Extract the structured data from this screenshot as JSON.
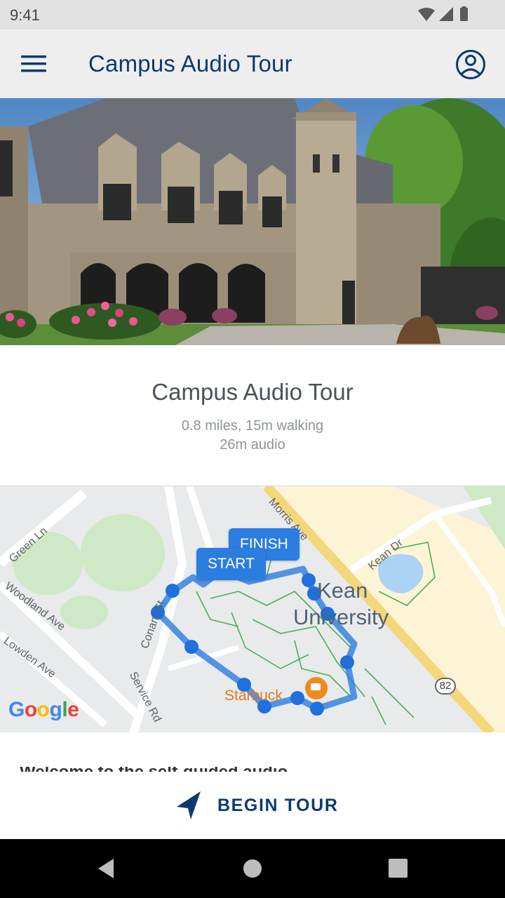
{
  "status_bar": {
    "time": "9:41",
    "icons": [
      "wifi-icon",
      "cell-signal-icon",
      "battery-icon"
    ]
  },
  "app_bar": {
    "menu_icon": "hamburger-menu-icon",
    "title": "Campus Audio Tour",
    "account_icon": "account-circle-icon"
  },
  "hero": {
    "image": "campus-building-photo"
  },
  "tour": {
    "title": "Campus Audio Tour",
    "distance": "0.8 miles, 15m walking",
    "audio": "26m audio"
  },
  "map": {
    "labels": {
      "green_ln": "Green Ln",
      "woodland_ave": "Woodland Ave",
      "lowden_ave": "Lowden Ave",
      "conant_st": "Conant St",
      "service_rd": "Service Rd",
      "morris_ave": "Morris Ave",
      "kean_dr": "Kean Dr",
      "kean_line1": "Kean",
      "kean_line2": "University",
      "starbucks": "Starbuck",
      "route_82": "82"
    },
    "finish_label": "FINISH",
    "start_label": "START",
    "attribution": "Google",
    "route_color": "#2b7de0"
  },
  "intro": {
    "text": "Welcome to the self-guided audio"
  },
  "begin_button": {
    "icon": "navigation-arrow-icon",
    "label": "BEGIN TOUR"
  },
  "nav_bar": {
    "icons": [
      "back-triangle-icon",
      "home-circle-icon",
      "recents-square-icon"
    ]
  },
  "colors": {
    "primary": "#0d3a6e",
    "route": "#2b7de0",
    "starbucks": "#e07b18"
  }
}
